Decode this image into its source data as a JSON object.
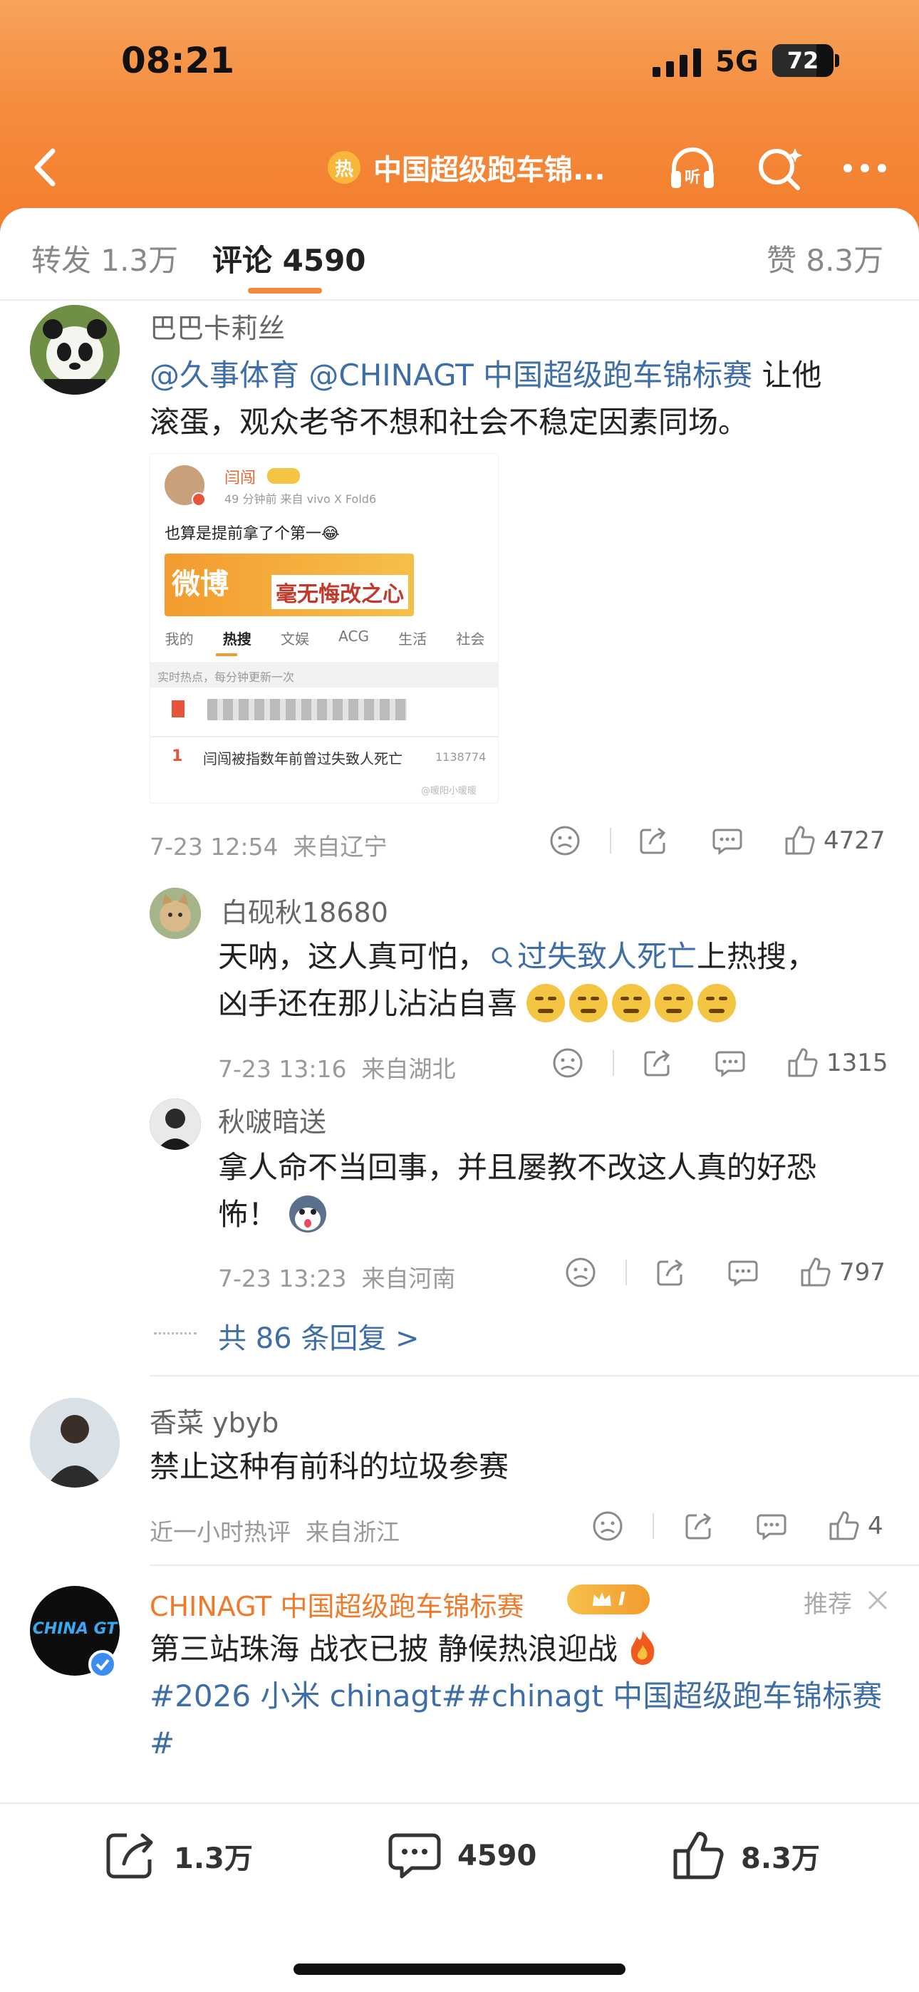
{
  "status_bar": {
    "time": "08:21",
    "network": "5G",
    "battery": "72",
    "battery_level": 0.72
  },
  "nav": {
    "title": "中国超级跑车锦...",
    "hot_badge": "热"
  },
  "tabs": [
    {
      "label": "转发 1.3万"
    },
    {
      "label": "评论 4590"
    },
    {
      "label": "赞 8.3万"
    }
  ],
  "comments": [
    {
      "user": "巴巴卡莉丝",
      "mentions": "@久事体育 @CHINAGT 中国超级跑车锦标赛",
      "text_a": " 让他",
      "text_b": "滚蛋，观众老爷不想和社会不稳定因素同场。",
      "time": "7-23 12:54",
      "location": "来自辽宁",
      "likes": "4727",
      "embedded_image": {
        "user": "闫闯",
        "meta": "49 分钟前  来自 vivo X Fold6",
        "post": "也算是提前拿了个第一😂",
        "banner": "毫无悔改之心",
        "tabs": [
          "我的",
          "热搜",
          "文娱",
          "ACG",
          "生活",
          "社会"
        ],
        "subtitle": "实时热点，每分钟更新一次",
        "rank": "1",
        "item": "闫闯被指数年前曾过失致人死亡",
        "count": "1138774",
        "watermark": "@暖阳小暖暖"
      }
    },
    {
      "user": "白砚秋18680",
      "text_a": "天呐，这人真可怕，",
      "topic": "过失致人死亡",
      "text_b": "上热搜，",
      "text_c": "凶手还在那儿沾沾自喜",
      "time": "7-23 13:16",
      "location": "来自湖北",
      "likes": "1315"
    },
    {
      "user": "秋啵暗送",
      "text_a": "拿人命不当回事，并且屡教不改这人真的好恐",
      "text_b": "怖！",
      "time": "7-23 13:23",
      "location": "来自河南",
      "likes": "797"
    }
  ],
  "replies_link": "共 86 条回复 >",
  "comment4": {
    "user": "香菜 ybyb",
    "text": "禁止这种有前科的垃圾参赛",
    "time": "近一小时热评",
    "location": "来自浙江",
    "likes": "4"
  },
  "promo": {
    "user": "CHINAGT 中国超级跑车锦标赛",
    "badge": "I",
    "recommend": "推荐",
    "avatar_text": "CHINA GT",
    "text_a": "第三站珠海 战衣已披 静候热浪迎战",
    "tags": "#2026 小米 chinagt##chinagt 中国超级跑车锦标赛",
    "tags_b": "#"
  },
  "bottom_bar": {
    "reposts": "1.3万",
    "comments": "4590",
    "likes": "8.3万"
  }
}
